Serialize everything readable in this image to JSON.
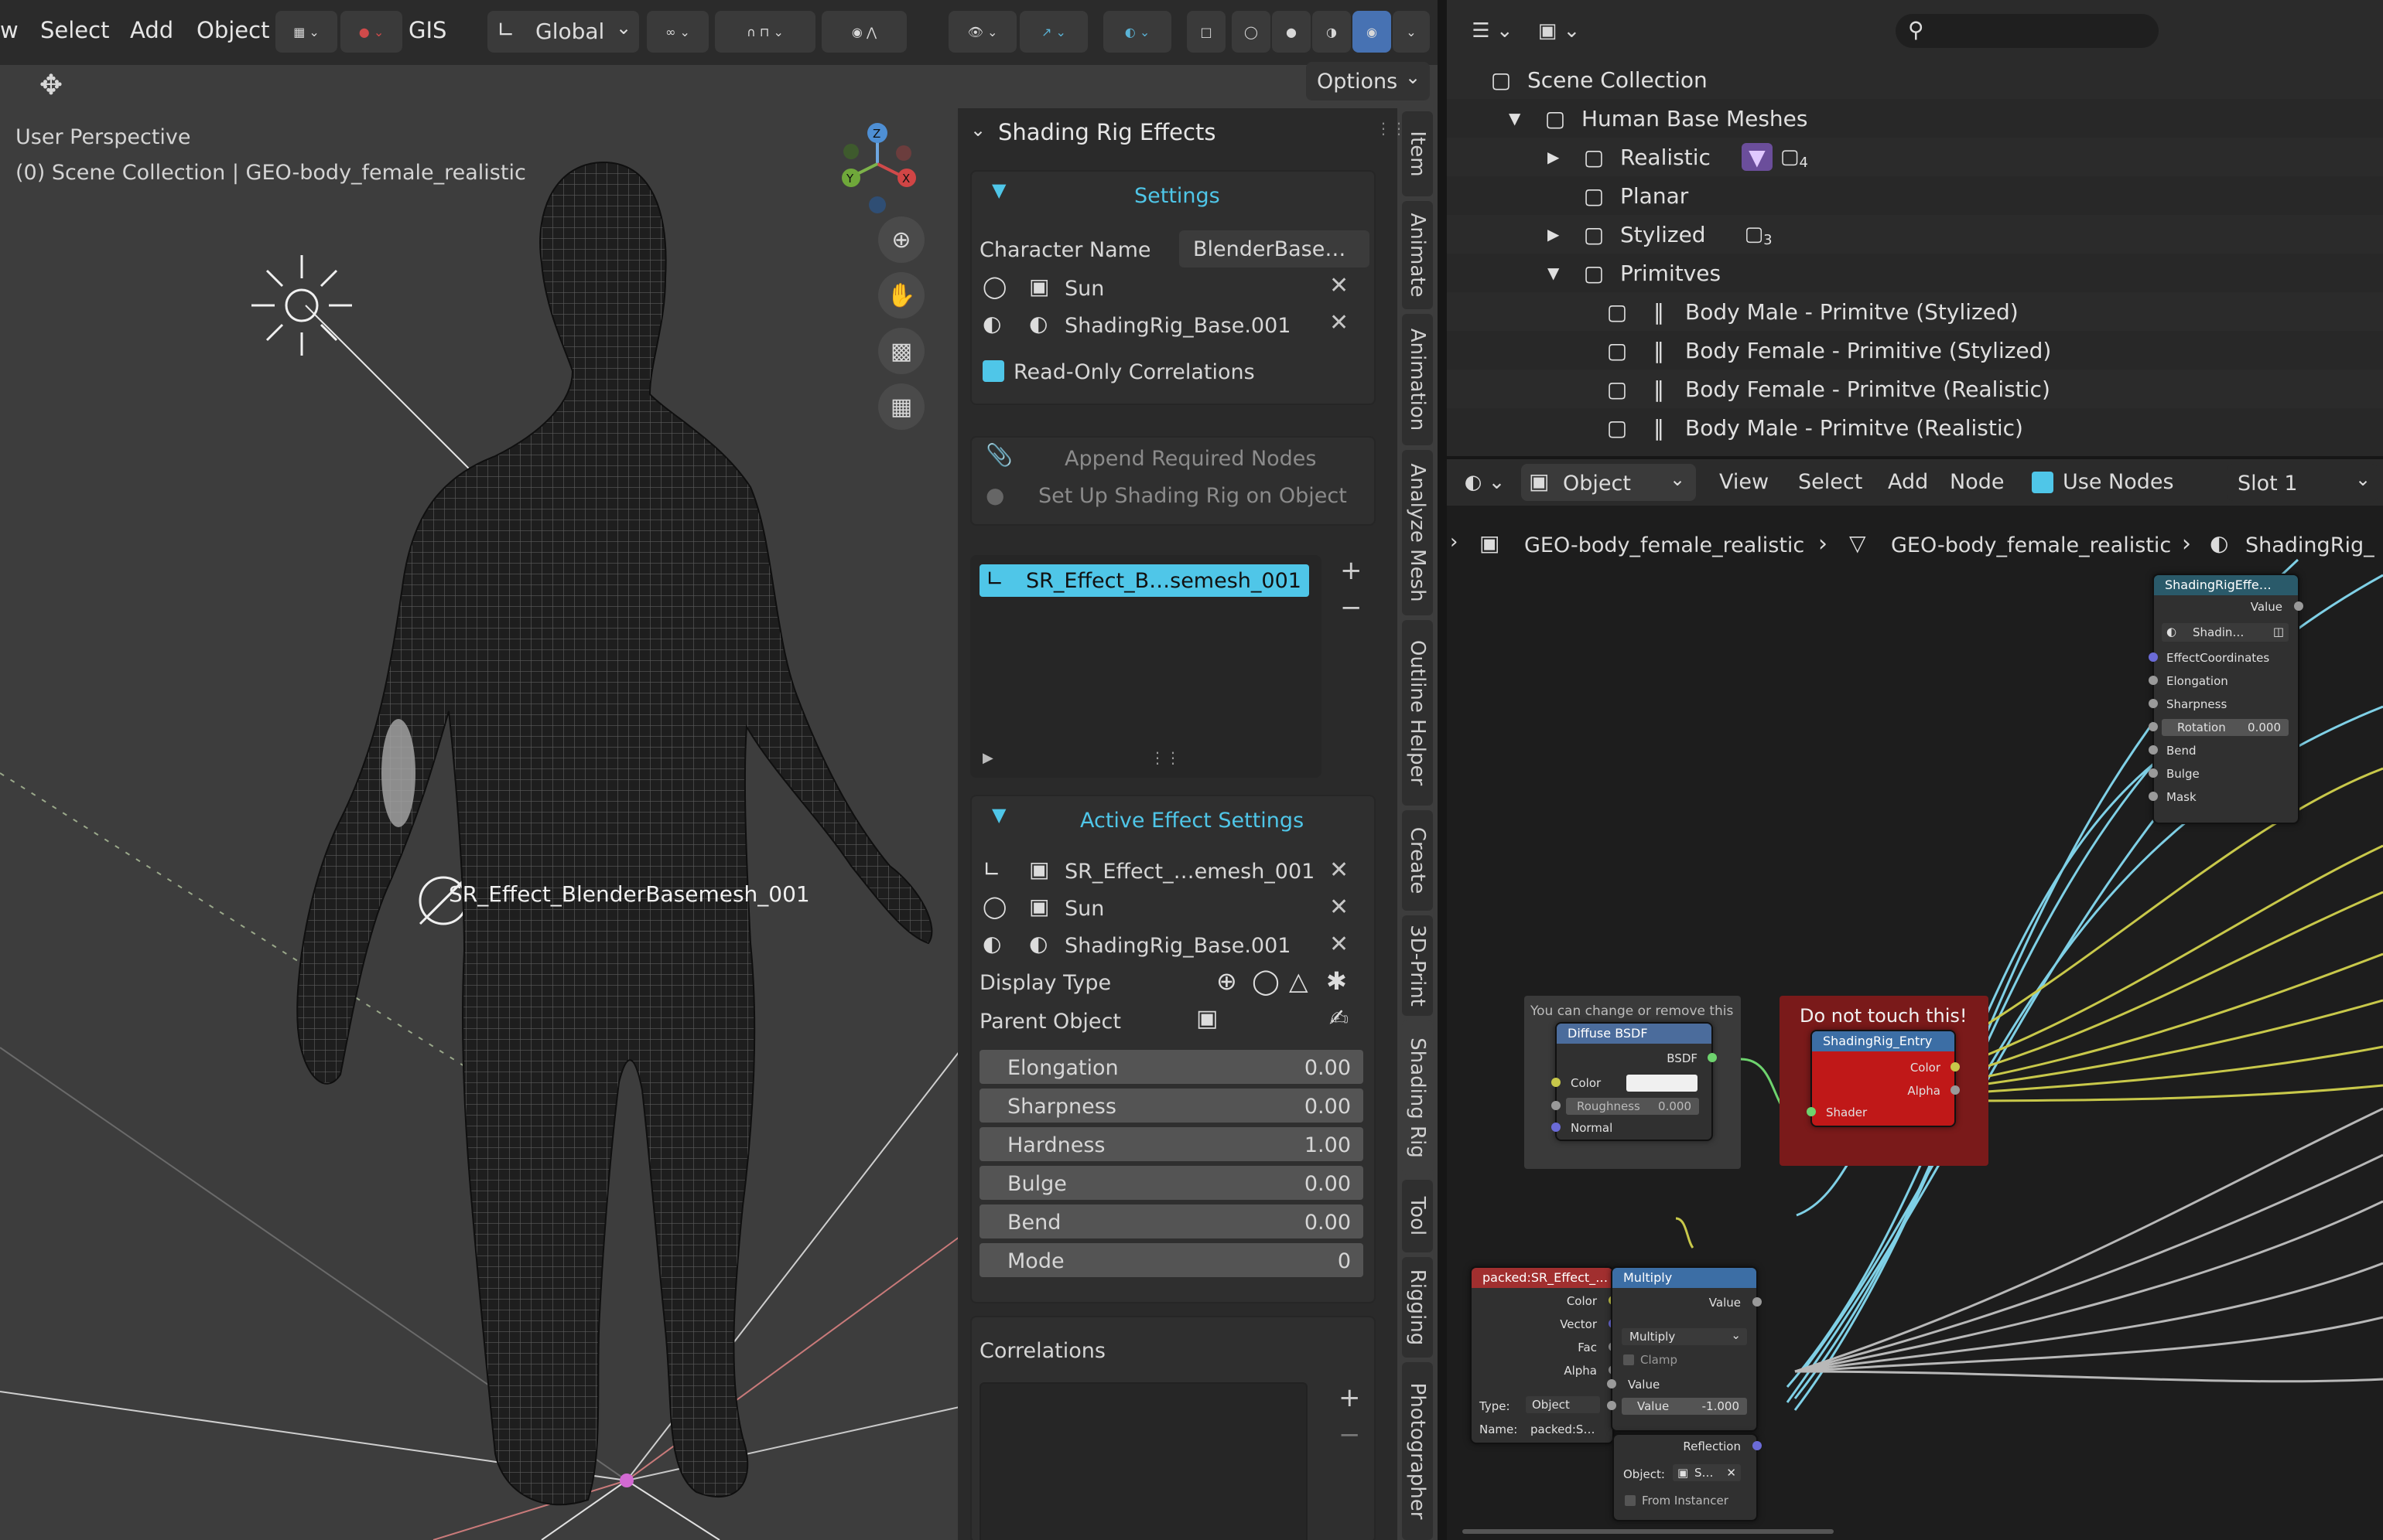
{
  "viewport": {
    "menu": [
      "w",
      "Select",
      "Add",
      "Object",
      "GIS"
    ],
    "orientation_label": "Global",
    "options_label": "Options",
    "overlay_line1": "User Perspective",
    "overlay_line2": "(0) Scene Collection | GEO-body_female_realistic",
    "effect_label": "SR_Effect_BlenderBasemesh_001",
    "gizmo_axes": {
      "z": "Z",
      "x": "X",
      "y": "Y"
    }
  },
  "npanel": {
    "title": "Shading Rig Effects",
    "settings_label": "Settings",
    "character_name_label": "Character Name",
    "character_name_value": "BlenderBase…",
    "sun_label": "Sun",
    "shading_base_label": "ShadingRig_Base.001",
    "readonly_label": "Read-Only Correlations",
    "append_label": "Append Required Nodes",
    "setup_label": "Set Up Shading Rig on Object",
    "effect_list_item": "SR_Effect_B…semesh_001",
    "active_effect_label": "Active Effect Settings",
    "active_effect_field": "SR_Effect_…emesh_001",
    "active_sun": "Sun",
    "active_shading_base": "ShadingRig_Base.001",
    "display_type_label": "Display Type",
    "parent_object_label": "Parent Object",
    "sliders": [
      {
        "label": "Elongation",
        "value": "0.00"
      },
      {
        "label": "Sharpness",
        "value": "0.00"
      },
      {
        "label": "Hardness",
        "value": "1.00"
      },
      {
        "label": "Bulge",
        "value": "0.00"
      },
      {
        "label": "Bend",
        "value": "0.00"
      },
      {
        "label": "Mode",
        "value": "0"
      }
    ],
    "correlations_label": "Correlations"
  },
  "side_tabs": [
    "Item",
    "Animate",
    "Animation",
    "Analyze Mesh",
    "Outline Helper",
    "Create",
    "3D-Print",
    "Shading Rig",
    "Tool",
    "Rigging",
    "Photographer"
  ],
  "outliner": {
    "rows": [
      {
        "label": "Scene Collection",
        "indent": 0,
        "arrow": ""
      },
      {
        "label": "Human Base Meshes",
        "indent": 1,
        "arrow": "▼"
      },
      {
        "label": "Realistic",
        "indent": 2,
        "arrow": "▶",
        "badge": "4"
      },
      {
        "label": "Planar",
        "indent": 2,
        "arrow": ""
      },
      {
        "label": "Stylized",
        "indent": 2,
        "arrow": "▶",
        "badge": "3"
      },
      {
        "label": "Primitves",
        "indent": 2,
        "arrow": "▼"
      },
      {
        "label": "Body Male - Primitve (Stylized)",
        "indent": 3,
        "arrow": ""
      },
      {
        "label": "Body Female - Primitive (Stylized)",
        "indent": 3,
        "arrow": ""
      },
      {
        "label": "Body Female - Primitve (Realistic)",
        "indent": 3,
        "arrow": ""
      },
      {
        "label": "Body Male - Primitve (Realistic)",
        "indent": 3,
        "arrow": ""
      }
    ]
  },
  "node_editor": {
    "object_label": "Object",
    "menu": [
      "View",
      "Select",
      "Add",
      "Node"
    ],
    "use_nodes_label": "Use Nodes",
    "slot_label": "Slot 1",
    "breadcrumb": [
      "GEO-body_female_realistic",
      "GEO-body_female_realistic",
      "ShadingRig_"
    ],
    "frame1_label": "You can change or remove this",
    "frame2_label": "Do not touch this!",
    "diffuse": {
      "title": "Diffuse BSDF",
      "out": "BSDF",
      "color": "Color",
      "roughness": "Roughness",
      "roughness_val": "0.000",
      "normal": "Normal"
    },
    "entry": {
      "title": "ShadingRig_Entry",
      "color": "Color",
      "alpha": "Alpha",
      "shader": "Shader"
    },
    "group": {
      "title": "ShadingRigEffe…",
      "value": "Value",
      "shadin": "Shadin…",
      "inputs": [
        "EffectCoordinates",
        "Elongation",
        "Sharpness"
      ],
      "rotation": "Rotation",
      "rotation_val": "0.000",
      "inputs2": [
        "Bend",
        "Bulge",
        "Mask"
      ]
    },
    "packed": {
      "title": "packed:SR_Effect_…",
      "outputs": [
        "Color",
        "Vector",
        "Fac",
        "Alpha"
      ],
      "type_label": "Type:",
      "type_val": "Object",
      "name_label": "Name:",
      "name_val": "packed:S…"
    },
    "multiply": {
      "title": "Multiply",
      "out": "Value",
      "mode": "Multiply",
      "clamp": "Clamp",
      "in_value": "Value",
      "value_label": "Value",
      "value_val": "-1.000"
    },
    "texcoord": {
      "reflection": "Reflection",
      "object_label": "Object:",
      "object_val": "S…",
      "from_instancer": "From Instancer"
    }
  }
}
